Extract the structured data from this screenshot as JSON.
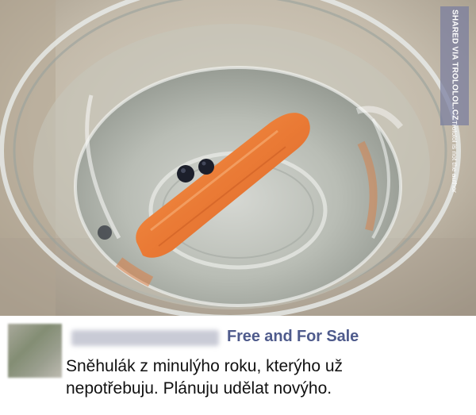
{
  "photo": {
    "watermark": {
      "text": "SHARED VIA TROLOLOL.CZ",
      "subtext": "Trololol is not the author"
    }
  },
  "post": {
    "author_name": "",
    "group_name": "Free and For Sale",
    "message_lines": [
      "Sněhulák z minulýho roku, kterýho už",
      "nepotřebuju. Plánuju udělat novýho."
    ]
  },
  "colors": {
    "group_link": "#4f5b8c",
    "message_text": "#111111"
  }
}
